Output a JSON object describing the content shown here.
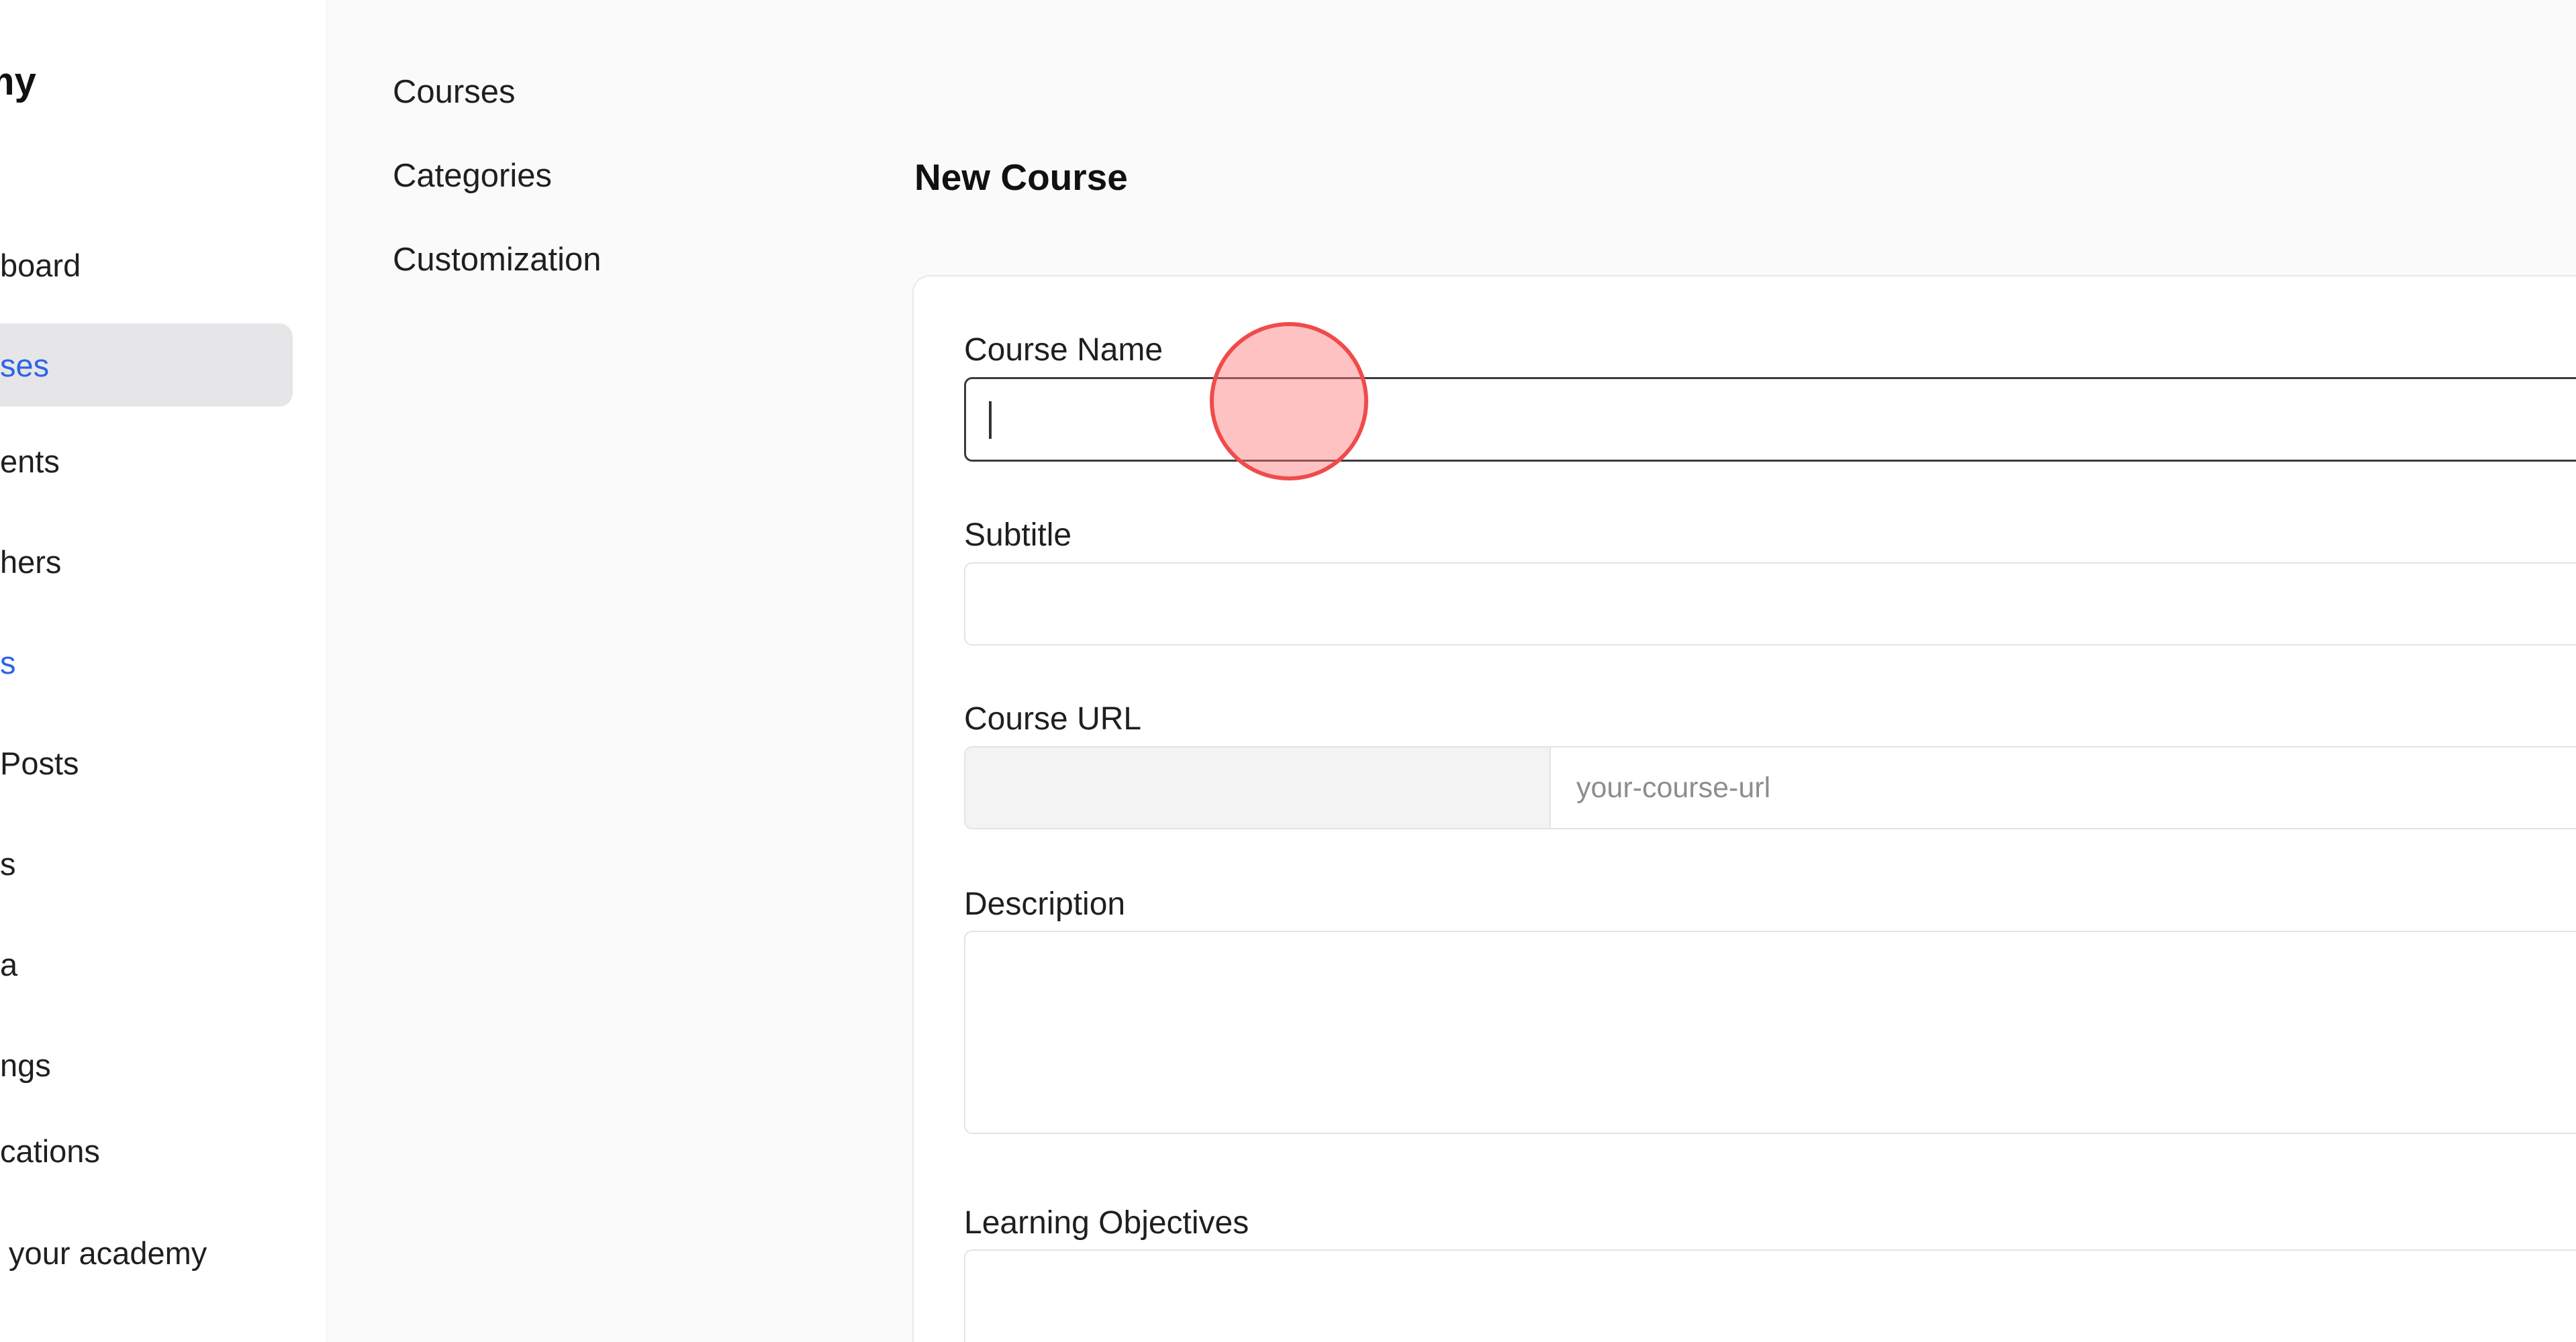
{
  "sidebar": {
    "brand": "my",
    "items": [
      {
        "label": "board",
        "state": "normal"
      },
      {
        "label": "ses",
        "state": "active"
      },
      {
        "label": "ents",
        "state": "normal"
      },
      {
        "label": "hers",
        "state": "normal"
      },
      {
        "label": "s",
        "state": "link"
      },
      {
        "label": "Posts",
        "state": "normal"
      },
      {
        "label": "s",
        "state": "normal"
      },
      {
        "label": "a",
        "state": "normal"
      },
      {
        "label": "ngs",
        "state": "normal"
      },
      {
        "label": "cations",
        "state": "normal"
      },
      {
        "label": " your academy",
        "state": "normal"
      }
    ]
  },
  "subnav": {
    "items": [
      "Courses",
      "Categories",
      "Customization"
    ]
  },
  "main": {
    "title": "New Course",
    "fields": {
      "course_name": {
        "label": "Course Name",
        "value": "",
        "placeholder": ""
      },
      "subtitle": {
        "label": "Subtitle",
        "value": "",
        "placeholder": ""
      },
      "course_url": {
        "label": "Course URL",
        "prefix": "",
        "value": "",
        "placeholder": "your-course-url"
      },
      "description": {
        "label": "Description",
        "value": "",
        "placeholder": ""
      },
      "learning_objectives": {
        "label": "Learning Objectives",
        "value": "",
        "placeholder": ""
      }
    }
  },
  "colors": {
    "accent": "#2c63e8",
    "active_bg": "#e6e6e8",
    "click_marker": "#f04b4b"
  }
}
